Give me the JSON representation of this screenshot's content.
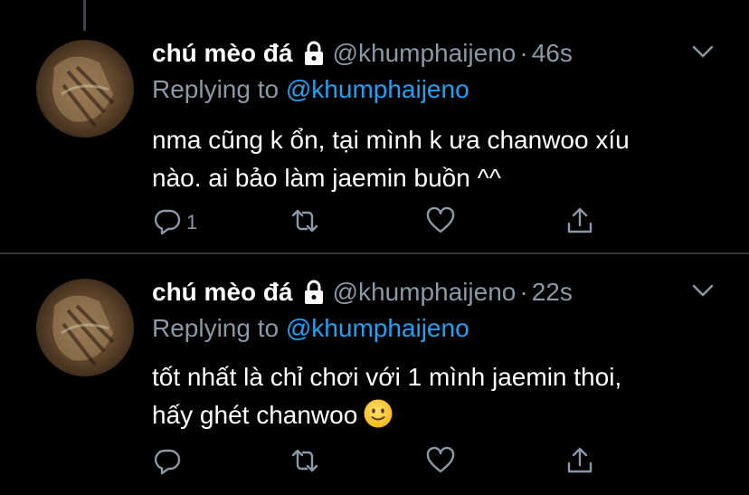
{
  "colors": {
    "background": "#000000",
    "secondary_text": "#8b98a5",
    "link": "#1da1f2",
    "primary_text": "#ffffff"
  },
  "tweets": [
    {
      "display_name": "chú mèo đá",
      "handle": "@khumphaijeno",
      "separator": "·",
      "time": "46s",
      "replying_prefix": "Replying to",
      "replying_handle": "@khumphaijeno",
      "text_lines": [
        "nma cũng k ổn, tại mình k ưa chanwoo xíu",
        "nào. ai bảo làm jaemin buồn ^^"
      ],
      "reply_count": "1",
      "icons": [
        "lock-icon",
        "reply-icon",
        "retweet-icon",
        "like-icon",
        "share-icon",
        "chevron-down-icon"
      ]
    },
    {
      "display_name": "chú mèo đá",
      "handle": "@khumphaijeno",
      "separator": "·",
      "time": "22s",
      "replying_prefix": "Replying to",
      "replying_handle": "@khumphaijeno",
      "text_lines": [
        "tốt nhất là chỉ chơi với 1 mình jaemin thoi,",
        "hấy ghét chanwoo"
      ],
      "emoji": "slightly-smiling-face",
      "reply_count": "",
      "icons": [
        "lock-icon",
        "reply-icon",
        "retweet-icon",
        "like-icon",
        "share-icon",
        "chevron-down-icon"
      ]
    }
  ]
}
